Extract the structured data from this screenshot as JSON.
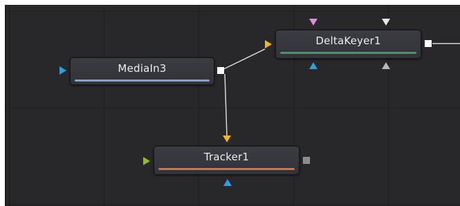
{
  "colors": {
    "canvas_bg": "#28282b",
    "grid_line": "#1e1e21",
    "node_bg": "#37383d",
    "link_line": "#d6d6d6",
    "media_in_bar": "#7fa4d6",
    "delta_keyer_bar": "#3f9a64",
    "tracker_bar": "#e0703a",
    "main_input_port": "#f0b41c",
    "media_in_input_port": "#2e9fe0",
    "tracker_input_port": "#8fbe1e",
    "mask_port": "#2e9fe0",
    "garbage_matte_port": "#e48ae0",
    "solid_matte_port": "#e8e8e8",
    "clean_plate_port": "#b8b8b8",
    "connected_output": "#ffffff",
    "unconnected_output": "#8a8a8a"
  },
  "nodes": {
    "media_in": {
      "label": "MediaIn3",
      "port_icon": "triangle-right-icon"
    },
    "delta_keyer": {
      "label": "DeltaKeyer1",
      "port_icon": "triangle-down-icon"
    },
    "tracker": {
      "label": "Tracker1",
      "port_icon": "triangle-right-icon"
    }
  }
}
